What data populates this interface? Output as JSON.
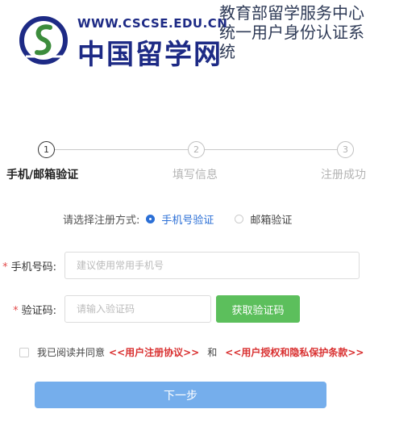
{
  "header": {
    "logo_url_text": "WWW.CSCSE.EDU.CN",
    "logo_cn_text": "中国留学网",
    "title": "教育部留学服务中心统一用户身份认证系统",
    "colors": {
      "brand_blue": "#1d2a85",
      "brand_green": "#3c8c3c"
    }
  },
  "stepper": {
    "steps": [
      {
        "number": "1",
        "label": "手机/邮箱验证",
        "active": true
      },
      {
        "number": "2",
        "label": "填写信息",
        "active": false
      },
      {
        "number": "3",
        "label": "注册成功",
        "active": false
      }
    ]
  },
  "method": {
    "label": "请选择注册方式:",
    "options": [
      {
        "label": "手机号验证",
        "selected": true
      },
      {
        "label": "邮箱验证",
        "selected": false
      }
    ]
  },
  "form": {
    "required_mark": "*",
    "phone": {
      "label": "手机号码:",
      "value": "",
      "placeholder": "建议使用常用手机号"
    },
    "code": {
      "label": "验证码:",
      "value": "",
      "placeholder": "请输入验证码"
    },
    "get_code_label": "获取验证码"
  },
  "agreement": {
    "checked": false,
    "prefix": "我已阅读并同意",
    "link1": "<<用户注册协议>>",
    "conj": "和",
    "link2": "<<用户授权和隐私保护条款>>"
  },
  "next_label": "下一步",
  "colors": {
    "accent": "#2b6fd6",
    "green_button": "#5cbf5c",
    "next_button": "#75aeec",
    "link_red": "#d93030"
  }
}
